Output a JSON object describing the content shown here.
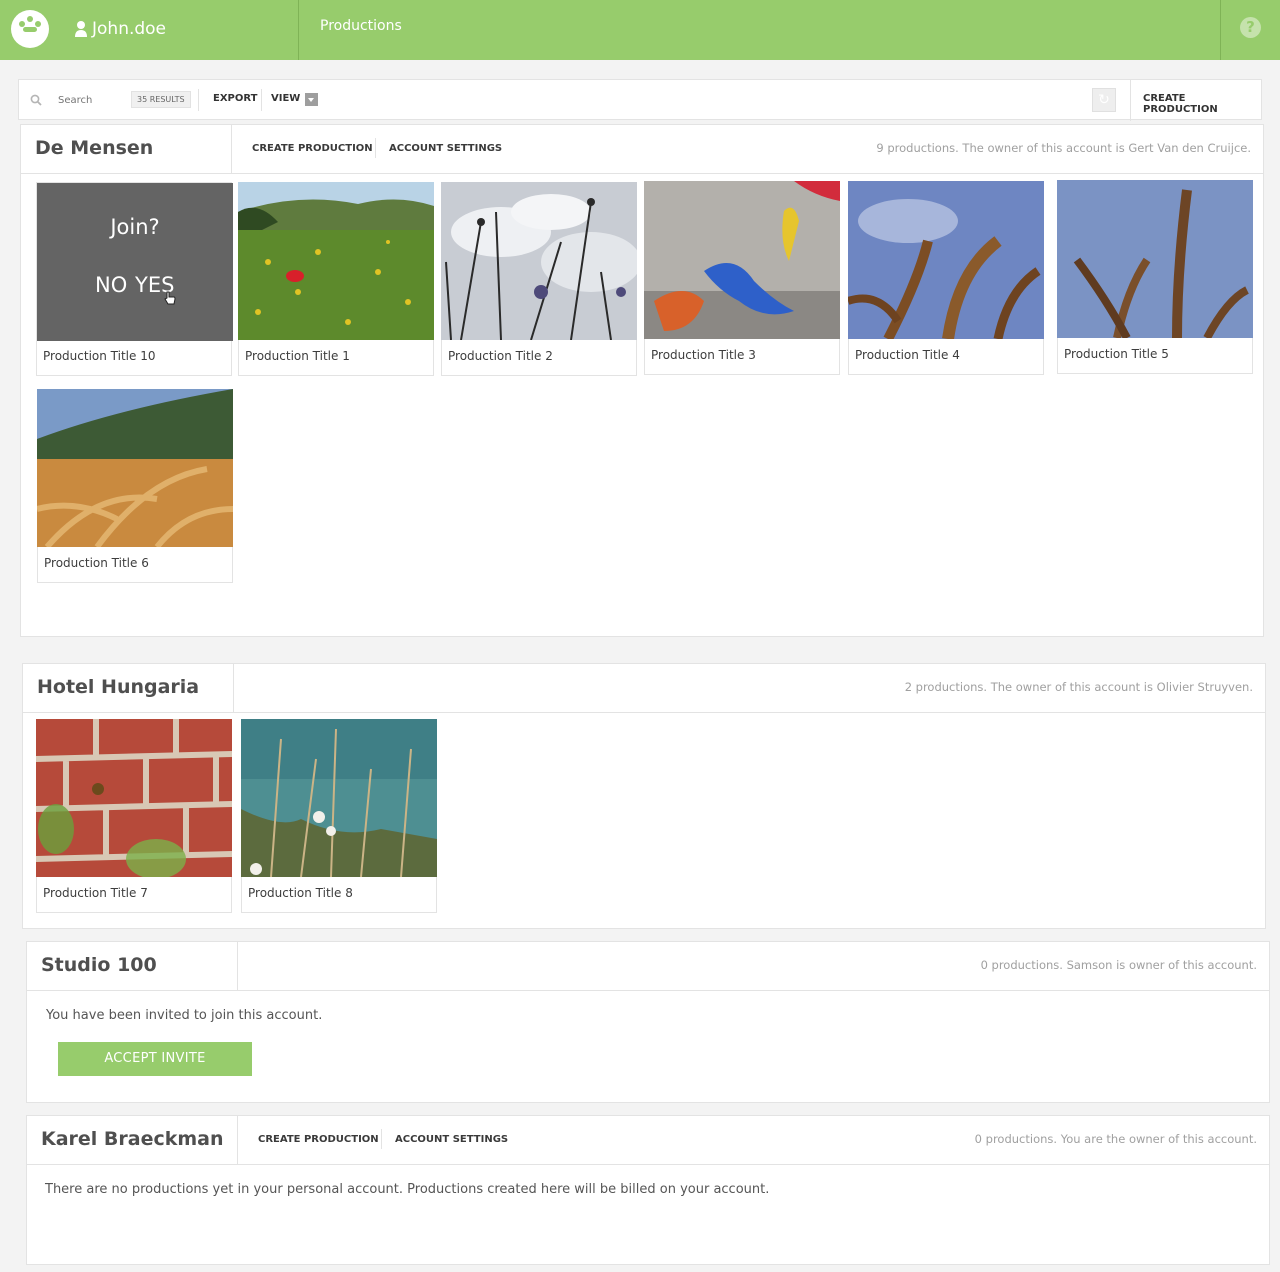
{
  "header": {
    "username": "John.doe",
    "section_title": "Productions",
    "help_symbol": "?"
  },
  "toolbar": {
    "search_placeholder": "Search",
    "result_count": "35 RESULTS",
    "export_label": "EXPORT",
    "view_label": "VIEW",
    "create_label": "CREATE PRODUCTION"
  },
  "accounts": [
    {
      "name": "De Mensen",
      "links": [
        "CREATE PRODUCTION",
        "ACCOUNT SETTINGS"
      ],
      "info": "9 productions. The owner of this account is Gert Van den Cruijce.",
      "productions": [
        {
          "title": "Production Title 10",
          "image": "join-overlay"
        },
        {
          "title": "Production Title 1",
          "image": "meadow-poppy"
        },
        {
          "title": "Production Title 2",
          "image": "wildflowers-sky"
        },
        {
          "title": "Production Title 3",
          "image": "painted-rock"
        },
        {
          "title": "Production Title 4",
          "image": "wheat-sky"
        },
        {
          "title": "Production Title 5",
          "image": "wheat-sky-2"
        },
        {
          "title": "Production Title 6",
          "image": "wheat-field"
        }
      ],
      "join_overlay": {
        "question": "Join?",
        "no": "NO",
        "yes": "YES"
      }
    },
    {
      "name": "Hotel Hungaria",
      "links": [],
      "info": "2 productions. The owner of this account is Olivier Struyven.",
      "productions": [
        {
          "title": "Production Title 7",
          "image": "spider-brick"
        },
        {
          "title": "Production Title 8",
          "image": "lake-flowers"
        }
      ]
    },
    {
      "name": "Studio 100",
      "links": [],
      "info": "0 productions. Samson is owner of this account.",
      "message": "You have been invited to join this account.",
      "accept_label": "ACCEPT INVITE"
    },
    {
      "name": "Karel Braeckman",
      "links": [
        "CREATE PRODUCTION",
        "ACCOUNT SETTINGS"
      ],
      "info": "0 productions. You are the owner of this account.",
      "message": "There are no productions yet in your personal account. Productions created here will be billed on your account."
    }
  ],
  "colors": {
    "accent": "#97cc6c",
    "overlay": "#646464"
  }
}
